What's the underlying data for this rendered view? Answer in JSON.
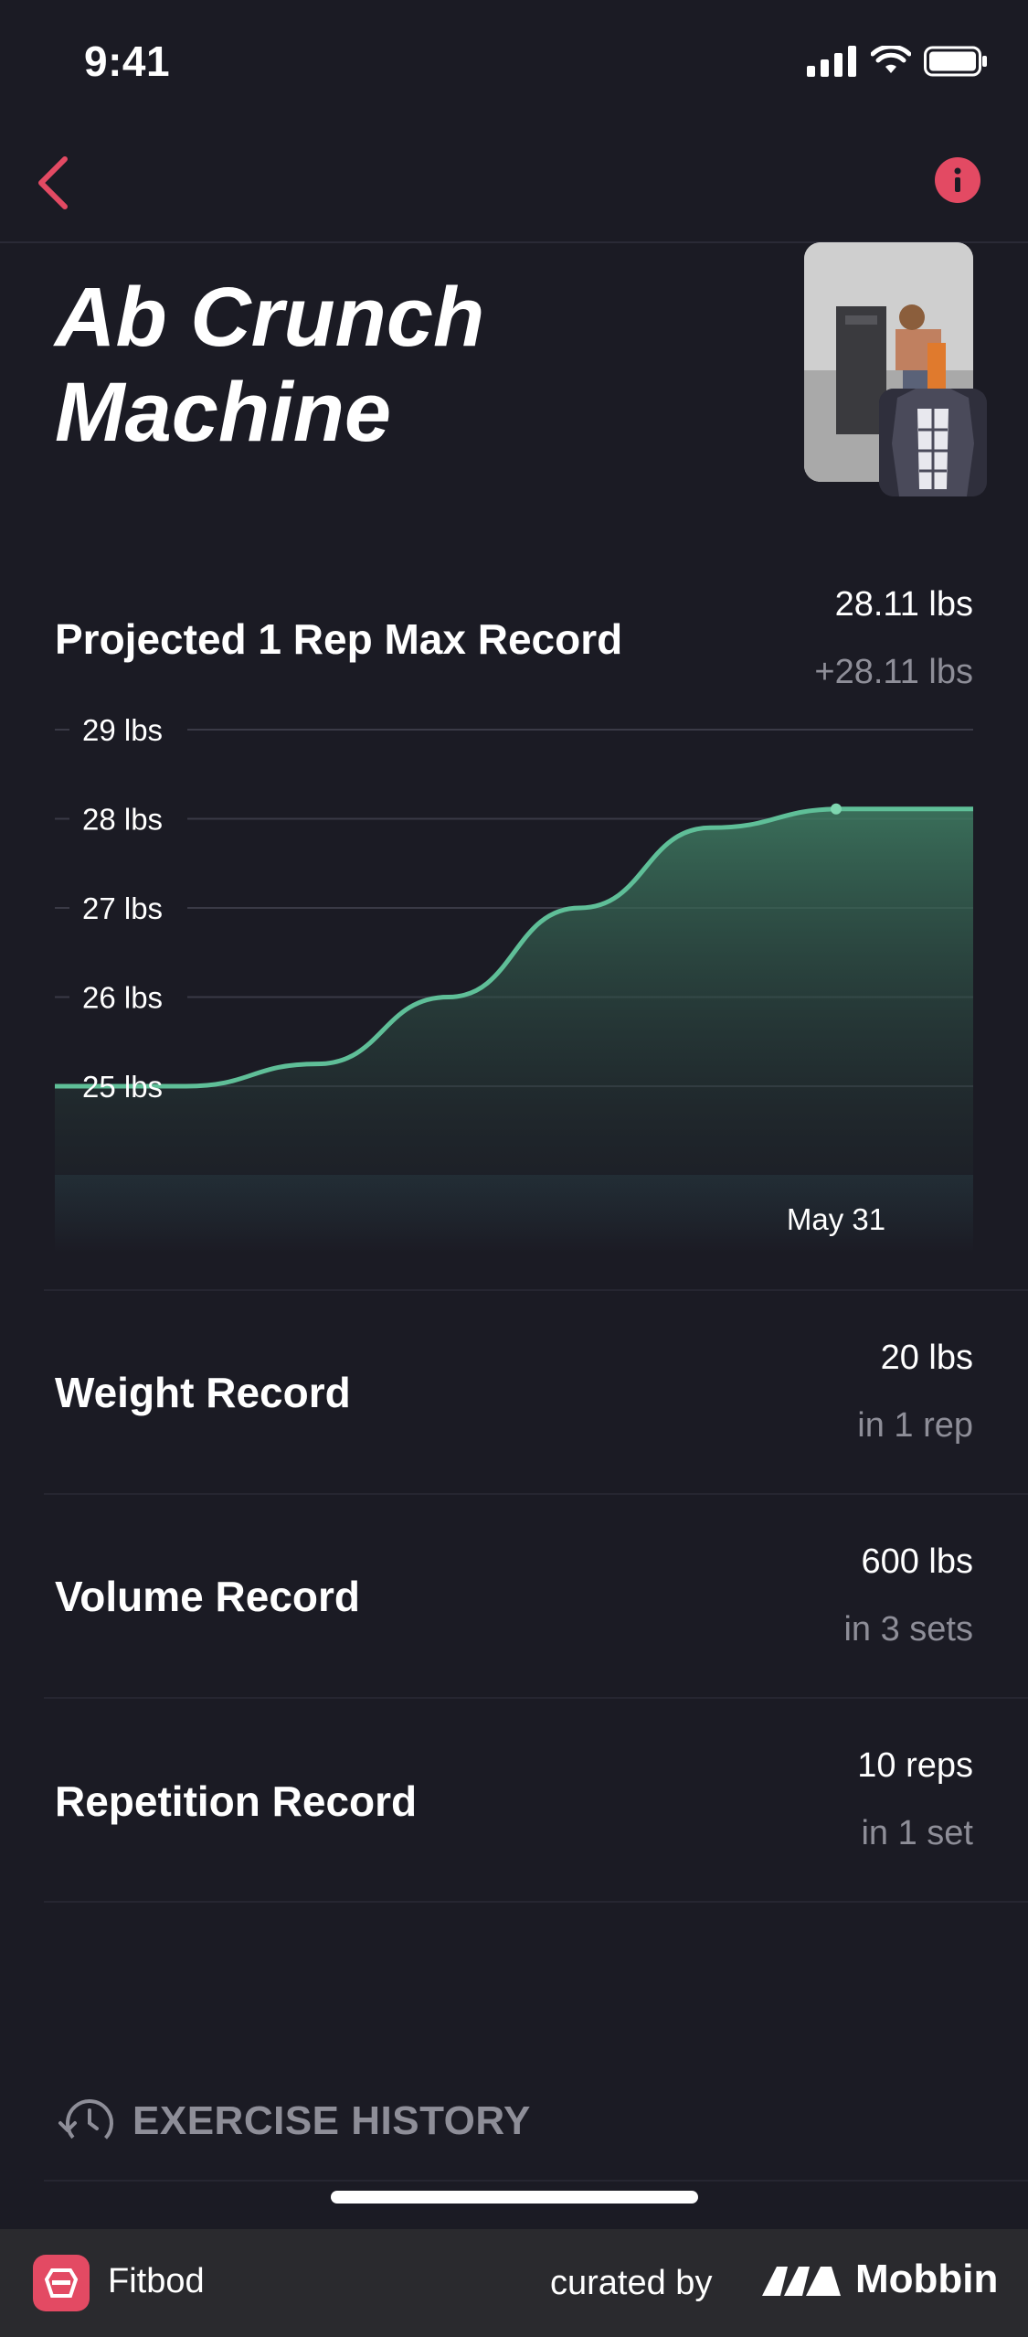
{
  "status_bar": {
    "time": "9:41"
  },
  "header": {
    "title_line1": "Ab Crunch",
    "title_line2": "Machine"
  },
  "projected": {
    "label": "Projected 1 Rep Max Record",
    "value": "28.11 lbs",
    "delta": "+28.11 lbs"
  },
  "chart_data": {
    "type": "area",
    "y_ticks": [
      "29 lbs",
      "28  lbs",
      "27  lbs",
      "26  lbs",
      "25 lbs"
    ],
    "y_tick_values": [
      29,
      28,
      27,
      26,
      25
    ],
    "ylim": [
      25,
      29
    ],
    "x_label_highlight": "May 31",
    "series": [
      {
        "values": [
          25,
          25,
          25.25,
          26,
          27,
          27.9,
          28.11,
          28.11
        ]
      }
    ],
    "grid": true,
    "colors": {
      "line": "#5fbf98",
      "fill": "#3f7d63"
    }
  },
  "records": [
    {
      "label": "Weight Record",
      "value": "20 lbs",
      "sub": "in 1 rep"
    },
    {
      "label": "Volume Record",
      "value": "600 lbs",
      "sub": "in 3 sets"
    },
    {
      "label": "Repetition Record",
      "value": "10 reps",
      "sub": "in 1 set"
    }
  ],
  "history": {
    "label": "EXERCISE HISTORY"
  },
  "footer": {
    "brand": "Fitbod",
    "curated_by": "curated by",
    "mobbin": "Mobbin"
  },
  "colors": {
    "accent": "#e34a63",
    "background": "#1b1b24",
    "muted": "#8e8e98",
    "chart_green": "#5fbf98"
  }
}
